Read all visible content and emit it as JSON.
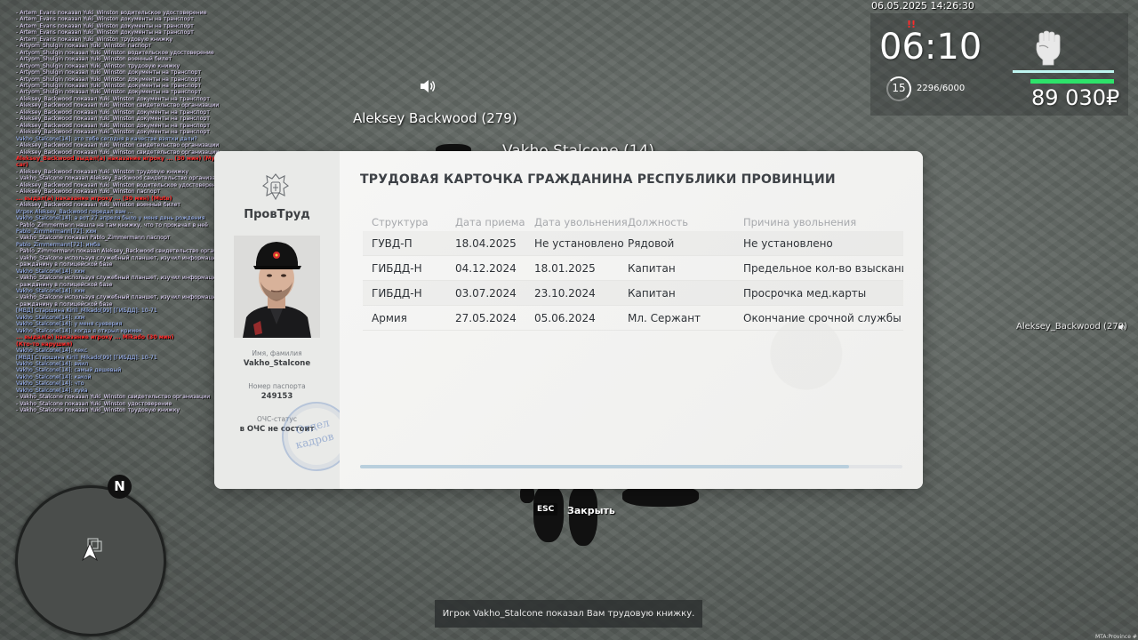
{
  "chat": [
    {
      "t": "Artem_Evans показал Yuki_Winston водительское удостоверение",
      "c": "me"
    },
    {
      "t": "Artem_Evans показал Yuki_Winston документы на транспорт",
      "c": "me"
    },
    {
      "t": "Artem_Evans показал Yuki_Winston документы на транспорт",
      "c": "me"
    },
    {
      "t": "Artem_Evans показал Yuki_Winston документы на транспорт",
      "c": "me"
    },
    {
      "t": "Artem_Evans показал Yuki_Winston трудовую книжку",
      "c": "me"
    },
    {
      "t": "Artyom_Shulgin показал Yuki_Winston паспорт",
      "c": "me"
    },
    {
      "t": "Artyom_Shulgin показал Yuki_Winston водительское удостоверение",
      "c": "me"
    },
    {
      "t": "Artyom_Shulgin показал Yuki_Winston военный билет",
      "c": "me"
    },
    {
      "t": "Artyom_Shulgin показал Yuki_Winston трудовую книжку",
      "c": "me"
    },
    {
      "t": "Artyom_Shulgin показал Yuki_Winston документы на транспорт",
      "c": "me"
    },
    {
      "t": "Artyom_Shulgin показал Yuki_Winston документы на транспорт",
      "c": "me"
    },
    {
      "t": "Artyom_Shulgin показал Yuki_Winston документы на транспорт",
      "c": "me"
    },
    {
      "t": "Artyom_Shulgin показал Yuki_Winston документы на транспорт",
      "c": "me"
    },
    {
      "t": "Aleksey_Backwood показал Yuki_Winston документы на транспорт",
      "c": "me"
    },
    {
      "t": "Aleksey_Backwood показал Yuki_Winston свидетельство организации",
      "c": "me"
    },
    {
      "t": "Aleksey_Backwood показал Yuki_Winston документы на транспорт",
      "c": "me"
    },
    {
      "t": "Aleksey_Backwood показал Yuki_Winston документы на транспорт",
      "c": "me"
    },
    {
      "t": "Aleksey_Backwood показал Yuki_Winston документы на транспорт",
      "c": "me"
    },
    {
      "t": "Aleksey_Backwood показал Yuki_Winston документы на транспорт",
      "c": "me"
    },
    {
      "t": "Vakho_Stalcone[14]: это тебе сегодня в качестве взятки дали?",
      "c": "pm"
    },
    {
      "t": "Aleksey_Backwood показал Yuki_Winston свидетельство организации",
      "c": "me"
    },
    {
      "t": "Aleksey_Backwood показал Yuki_Winston свидетельство организации",
      "c": "me"
    },
    {
      "t": "Aleksey_Backwood выдал(а) наказание игроку ... (30 мин) (Музыка в",
      "c": "adm"
    },
    {
      "t": "car)",
      "c": "adm"
    },
    {
      "t": "Aleksey_Backwood показал Yuki_Winston трудовую книжку",
      "c": "me"
    },
    {
      "t": "Vakho_Stalcone показал Aleksey_Backwood свидетельство организации",
      "c": "me"
    },
    {
      "t": "Aleksey_Backwood показал Yuki_Winston водительское удостоверение",
      "c": "me"
    },
    {
      "t": "Aleksey_Backwood показал Yuki_Winston паспорт",
      "c": "me"
    },
    {
      "t": "... выдал(а) наказание игроку ... (30 мин) (Mute)",
      "c": "adm"
    },
    {
      "t": "Aleksey_Backwood показал Yuki_Winston военный билет",
      "c": "me"
    },
    {
      "t": "Игрок Aleksey_Backwood передал вам ...",
      "c": "pm"
    },
    {
      "t": "Vakho_Stalcone[14]: а вот 27 апреля было у меня день рождения",
      "c": "pm"
    },
    {
      "t": "Pablo_Zimmermann нашла на там книжку, что то прокачал в неё",
      "c": "me"
    },
    {
      "t": "Pablo_Zimmermann[72]: ххм",
      "c": "pm"
    },
    {
      "t": "Vakho_Stalcone показал Pablo_Zimmermann паспорт",
      "c": "me"
    },
    {
      "t": "Pablo_Zimmermann[72]: имба",
      "c": "pm"
    },
    {
      "t": "Pablo_Zimmermann показал Aleksey_Backwood свидетельство организации",
      "c": "me"
    },
    {
      "t": "Vakho_Stalcone используя служебный планшет, изучил информацию по г",
      "c": "me"
    },
    {
      "t": "ражданину в полицейской базе",
      "c": "me"
    },
    {
      "t": "Vakho_Stalcone[14]: ххм",
      "c": "pm"
    },
    {
      "t": "Vakho_Stalcone используя служебный планшет, изучил информацию по г",
      "c": "me"
    },
    {
      "t": "ражданину в полицейской базе",
      "c": "me"
    },
    {
      "t": "Vakho_Stalcone[14]: ххм",
      "c": "pm"
    },
    {
      "t": "Vakho_Stalcone используя служебный планшет, изучил информацию по г",
      "c": "me"
    },
    {
      "t": "ражданину в полицейской базе",
      "c": "me"
    },
    {
      "t": "[МВД] Старшина Kirill_Mikado[99] [ГИБДД]: 10-71",
      "c": "pm"
    },
    {
      "t": "Vakho_Stalcone[14]: ххм",
      "c": "pm"
    },
    {
      "t": "Vakho_Stalcone[14]: у меня суеверия",
      "c": "pm"
    },
    {
      "t": "Vakho_Stalcone[14]: когда я открыл кримек",
      "c": "pm"
    },
    {
      "t": "... выдал(а) наказание игроку ... Mikado (30 мин)",
      "c": "adm"
    },
    {
      "t": "(Кто-то нарушил)",
      "c": "adm"
    },
    {
      "t": "Vakho_Stalcone[14]: кекс",
      "c": "pm"
    },
    {
      "t": "[МВД] Старшина Kirill_Mikado[99] [ГИБДД]: 10-71",
      "c": "pm"
    },
    {
      "t": "Vakho_Stalcone[14]: виил",
      "c": "pm"
    },
    {
      "t": "Vakho_Stalcone[14]: самый дешевый",
      "c": "pm"
    },
    {
      "t": "Vakho_Stalcone[14]: какой",
      "c": "pm"
    },
    {
      "t": "Vakho_Stalcone[14]: что",
      "c": "pm"
    },
    {
      "t": "Vakho_Stalcone[14]: хуйа",
      "c": "pm"
    },
    {
      "t": "Vakho_Stalcone показал Yuki_Winston свидетельство организации",
      "c": "me"
    },
    {
      "t": "Vakho_Stalcone показал Yuki_Winston удостоверение",
      "c": "me"
    },
    {
      "t": "Vakho_Stalcone показал Yuki_Winston трудовую книжку",
      "c": "me"
    }
  ],
  "hud": {
    "datetime": "06.05.2025 14:26:30",
    "clock": "06:10",
    "level": "15",
    "exp": "2296/6000",
    "money": "89 030₽",
    "health": 1.0,
    "armor": 1.0,
    "weapon_icon": "fist-icon",
    "alert": "!!",
    "alert_color": "#ff2a2a",
    "health_color": "#bff5f0",
    "armor_color": "#2de36a"
  },
  "world": {
    "nametag_aleksey": "Aleksey Backwood (279)",
    "nametag_vakho": "Vakho Stalcone (14)",
    "nametag_aleksey_right": "Aleksey_Backwood (279)",
    "speaker_icon": "speaker-icon"
  },
  "workbook": {
    "org_name": "ПровТруд",
    "emblem_icon": "coat-of-arms-icon",
    "name_label": "Имя, фамилия",
    "name_value": "Vakho_Stalcone",
    "passport_label": "Номер паспорта",
    "passport_value": "249153",
    "ochs_label": "ОЧС-статус",
    "ochs_value": "в ОЧС не состоит",
    "stamp_line1": "Отдел",
    "stamp_line2": "кадров",
    "title": "ТРУДОВАЯ КАРТОЧКА ГРАЖДАНИНА РЕСПУБЛИКИ ПРОВИНЦИИ",
    "columns": [
      "Структура",
      "Дата приема",
      "Дата увольнения",
      "Должность",
      "Причина увольнения"
    ],
    "rows": [
      [
        "ГУВД-П",
        "18.04.2025",
        "Не установлено",
        "Рядовой",
        "Не установлено"
      ],
      [
        "ГИБДД-Н",
        "04.12.2024",
        "18.01.2025",
        "Капитан",
        "Предельное кол-во взысканий"
      ],
      [
        "ГИБДД-Н",
        "03.07.2024",
        "23.10.2024",
        "Капитан",
        "Просрочка мед.карты"
      ],
      [
        "Армия",
        "27.05.2024",
        "05.06.2024",
        "Мл. Сержант",
        "Окончание срочной службы"
      ]
    ]
  },
  "close_hint": {
    "key": "ESC",
    "label": "Закрыть"
  },
  "minimap": {
    "north": "N"
  },
  "notification": "Игрок Vakho_Stalcone показал Вам трудовую книжку.",
  "watermark": "MTA:Province #"
}
